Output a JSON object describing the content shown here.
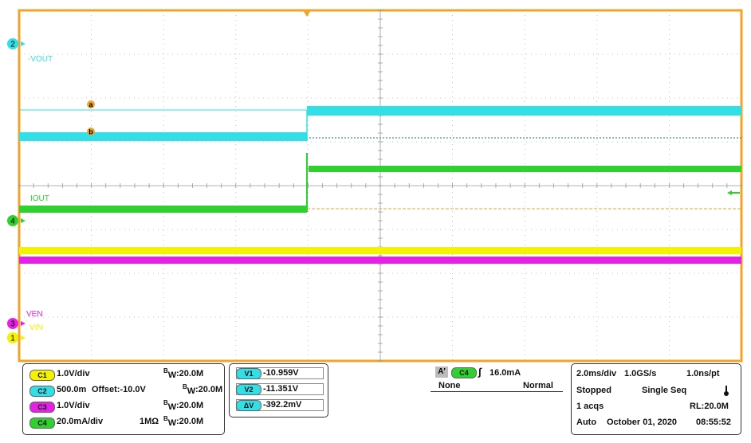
{
  "colors": {
    "ch1": "#f5f200",
    "ch2": "#33dfe6",
    "ch3": "#e620e6",
    "ch4": "#2ed12e",
    "frame": "#f0a52a",
    "trigger": "#f0a52a"
  },
  "waveform": {
    "ch2_label": "-VOUT",
    "ch4_label": "IOUT",
    "ch3_label": "VEN",
    "ch1_label": "VIN",
    "ch1_marker": "1",
    "ch2_marker": "2",
    "ch3_marker": "3",
    "ch4_marker": "4",
    "cursor_a": "a",
    "cursor_b": "b"
  },
  "channels": [
    {
      "badge": "C1",
      "scale": "1.0V/div",
      "offset": "",
      "impedance": "",
      "bw_b": "B",
      "bw_w": "W",
      "bw": ":20.0M"
    },
    {
      "badge": "C2",
      "scale": "500.0m",
      "offset": "Offset:-10.0V",
      "impedance": "",
      "bw_b": "B",
      "bw_w": "W",
      "bw": ":20.0M"
    },
    {
      "badge": "C3",
      "scale": "1.0V/div",
      "offset": "",
      "impedance": "",
      "bw_b": "B",
      "bw_w": "W",
      "bw": ":20.0M"
    },
    {
      "badge": "C4",
      "scale": "20.0mA/div",
      "offset": "",
      "impedance": "1MΩ",
      "bw_b": "B",
      "bw_w": "W",
      "bw": ":20.0M"
    }
  ],
  "cursors": [
    {
      "badge": "V1",
      "value": "-10.959V"
    },
    {
      "badge": "V2",
      "value": "-11.351V"
    },
    {
      "badge": "ΔV",
      "value": "-392.2mV"
    }
  ],
  "trigger": {
    "prefix": "A'",
    "source": "C4",
    "slope_glyph": "∫",
    "level": "16.0mA",
    "coupling": "None",
    "mode": "Normal"
  },
  "acquisition": {
    "timebase": "2.0ms/div",
    "sample_rate": "1.0GS/s",
    "resolution": "1.0ns/pt",
    "state": "Stopped",
    "sequence": "Single Seq",
    "acqs": "1 acqs",
    "record_length": "RL:20.0M",
    "mode": "Auto",
    "date": "October 01, 2020",
    "time": "08:55:52",
    "thermometer_icon": "thermometer-icon"
  }
}
